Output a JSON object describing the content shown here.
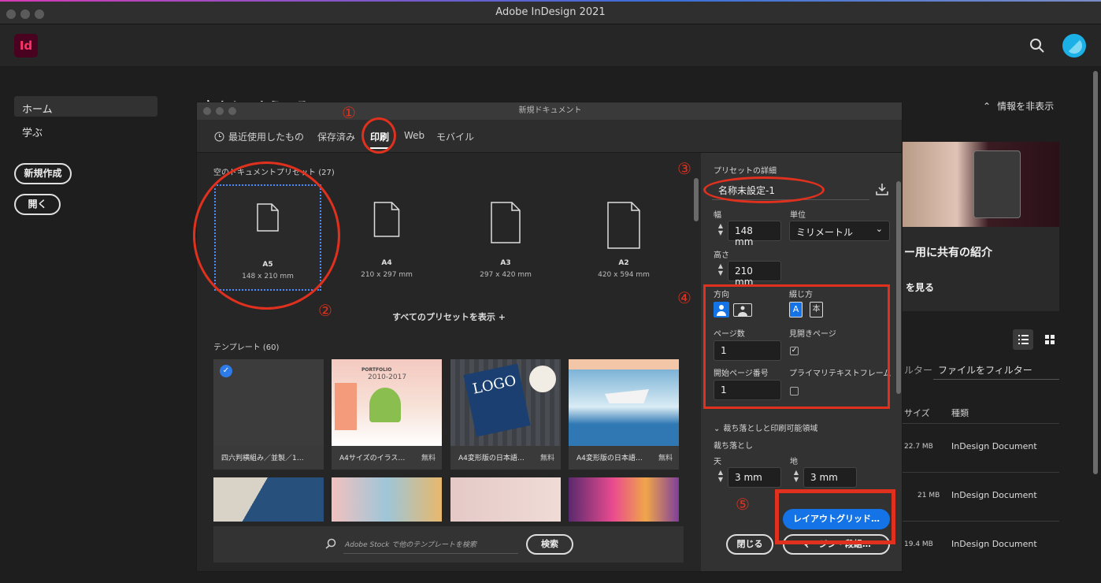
{
  "window": {
    "title": "Adobe InDesign 2021"
  },
  "app": {
    "logo": "Id"
  },
  "leftnav": {
    "home": "ホーム",
    "learn": "学ぶ",
    "new": "新規作成",
    "open": "開く"
  },
  "home": {
    "welcome": "高さん、ようこそ",
    "hide_info": "情報を非表示",
    "promo_title": "ー用に共有の紹介",
    "promo_link": "を見る",
    "filter_label": "ルター",
    "filter_placeholder": "ファイルをフィルター",
    "col_size": "サイズ",
    "col_type": "種類",
    "files": [
      {
        "size": "22.7 MB",
        "type": "InDesign Document"
      },
      {
        "size": "21 MB",
        "type": "InDesign Document"
      },
      {
        "size": "19.4 MB",
        "type": "InDesign Document"
      }
    ]
  },
  "dialog": {
    "title": "新規ドキュメント",
    "tabs": {
      "recent": "最近使用したもの",
      "saved": "保存済み",
      "print": "印刷",
      "web": "Web",
      "mobile": "モバイル"
    },
    "presets_header": "空のドキュメントプリセット",
    "presets_count": "(27)",
    "presets": [
      {
        "name": "A5",
        "dims": "148 x 210 mm"
      },
      {
        "name": "A4",
        "dims": "210 x 297 mm"
      },
      {
        "name": "A3",
        "dims": "297 x 420 mm"
      },
      {
        "name": "A2",
        "dims": "420 x 594 mm"
      }
    ],
    "show_all": "すべてのプリセットを表示 +",
    "templates_header": "テンプレート",
    "templates_count": "(60)",
    "templates": [
      {
        "caption": "四六判横組み／並製／1…",
        "free": ""
      },
      {
        "caption": "A4サイズのイラス…",
        "free": "無料"
      },
      {
        "caption": "A4変形版の日本語…",
        "free": "無料"
      },
      {
        "caption": "A4変形版の日本語…",
        "free": "無料"
      }
    ],
    "template_texts": {
      "portfolio": "PORTFOLIO",
      "year": "2010-2017",
      "logo": "LOGO"
    },
    "search_placeholder": "Adobe Stock で他のテンプレートを検索",
    "search_button": "検索",
    "details": {
      "header": "プリセットの詳細",
      "name": "名称未設定-1",
      "width_label": "幅",
      "width": "148 mm",
      "unit_label": "単位",
      "unit": "ミリメートル",
      "height_label": "高さ",
      "height": "210 mm",
      "orientation_label": "方向",
      "binding_label": "綴じ方",
      "pages_label": "ページ数",
      "pages": "1",
      "facing_label": "見開きページ",
      "start_label": "開始ページ番号",
      "start": "1",
      "primary_label": "プライマリテキストフレーム",
      "bleed_section": "裁ち落としと印刷可能領域",
      "bleed_label": "裁ち落とし",
      "top_label": "天",
      "top": "3 mm",
      "bottom_label": "地",
      "bottom": "3 mm"
    },
    "buttons": {
      "close": "閉じる",
      "layout_grid": "レイアウトグリッド…",
      "margin": "マージン・段組…"
    }
  },
  "annotations": {
    "n1": "①",
    "n2": "②",
    "n3": "③",
    "n4": "④",
    "n5": "⑤"
  },
  "colors": {
    "accent": "#1473e6",
    "annotation": "#e0301e",
    "logo_bg": "#49021f"
  }
}
